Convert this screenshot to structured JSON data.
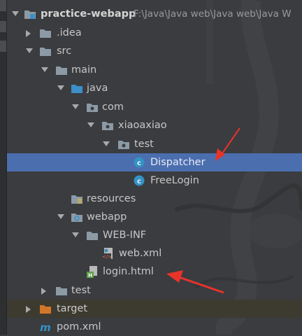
{
  "tree": {
    "root": {
      "label": "practice-webapp",
      "path": "F:\\Java\\Java web\\Java web\\Java W"
    },
    "items": [
      {
        "label": ".idea"
      },
      {
        "label": "src"
      },
      {
        "label": "main"
      },
      {
        "label": "java"
      },
      {
        "label": "com"
      },
      {
        "label": "xiaoaxiao"
      },
      {
        "label": "test"
      },
      {
        "label": "Dispatcher"
      },
      {
        "label": "FreeLogin"
      },
      {
        "label": "resources"
      },
      {
        "label": "webapp"
      },
      {
        "label": "WEB-INF"
      },
      {
        "label": "web.xml"
      },
      {
        "label": "login.html"
      },
      {
        "label": "test"
      },
      {
        "label": "target"
      },
      {
        "label": "pom.xml"
      }
    ]
  },
  "colors": {
    "selection": "#4b6eaf",
    "annotation_arrow": "#e8332b",
    "folder": "#8c9aa5",
    "source_folder": "#3d8fc9",
    "excluded_folder": "#d2762a",
    "class_icon": "#3592c4"
  },
  "icons": {
    "project": "module-folder-icon",
    "folder": "folder-icon",
    "source_root": "source-folder-icon",
    "package": "package-icon",
    "resources": "resources-folder-icon",
    "web": "web-folder-icon",
    "class": "class-icon",
    "xml": "xml-file-icon",
    "html": "html-file-icon",
    "excluded": "excluded-folder-icon",
    "maven": "maven-icon"
  }
}
